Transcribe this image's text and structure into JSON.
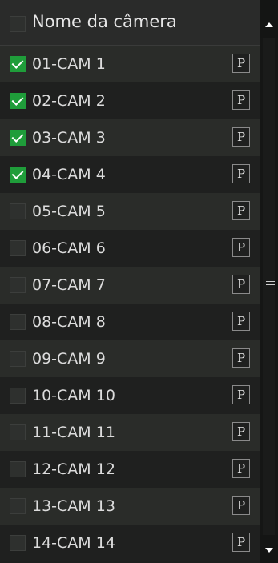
{
  "header": {
    "title": "Nome da câmera",
    "select_all_checked": false
  },
  "cameras": [
    {
      "label": "01-CAM 1",
      "checked": true,
      "button": "P"
    },
    {
      "label": "02-CAM 2",
      "checked": true,
      "button": "P"
    },
    {
      "label": "03-CAM 3",
      "checked": true,
      "button": "P"
    },
    {
      "label": "04-CAM 4",
      "checked": true,
      "button": "P"
    },
    {
      "label": "05-CAM 5",
      "checked": false,
      "button": "P"
    },
    {
      "label": "06-CAM 6",
      "checked": false,
      "button": "P"
    },
    {
      "label": "07-CAM 7",
      "checked": false,
      "button": "P"
    },
    {
      "label": "08-CAM 8",
      "checked": false,
      "button": "P"
    },
    {
      "label": "09-CAM 9",
      "checked": false,
      "button": "P"
    },
    {
      "label": "10-CAM 10",
      "checked": false,
      "button": "P"
    },
    {
      "label": "11-CAM 11",
      "checked": false,
      "button": "P"
    },
    {
      "label": "12-CAM 12",
      "checked": false,
      "button": "P"
    },
    {
      "label": "13-CAM 13",
      "checked": false,
      "button": "P"
    },
    {
      "label": "14-CAM 14",
      "checked": false,
      "button": "P"
    }
  ],
  "colors": {
    "checked": "#1f9d3a",
    "text": "#dcdcdc"
  },
  "icons": {
    "scroll_up": "triangle-up-icon",
    "scroll_down": "triangle-down-icon",
    "scroll_grip": "hamburger-grip-icon"
  }
}
